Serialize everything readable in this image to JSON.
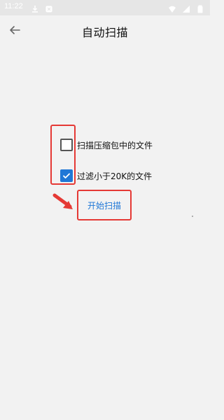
{
  "status_bar": {
    "time": "11:22",
    "icons": [
      "download-icon",
      "notification-icon",
      "wifi-icon",
      "signal-icon",
      "battery-icon"
    ]
  },
  "app_bar": {
    "title": "自动扫描",
    "back_icon": "arrow-left-icon"
  },
  "options": [
    {
      "label": "扫描压缩包中的文件",
      "checked": false
    },
    {
      "label": "过滤小于20K的文件",
      "checked": true
    }
  ],
  "start_button": {
    "label": "开始扫描"
  },
  "annotations": {
    "color": "#e53935"
  },
  "colors": {
    "accent": "#1f77d6",
    "background": "#f2f2f2"
  }
}
